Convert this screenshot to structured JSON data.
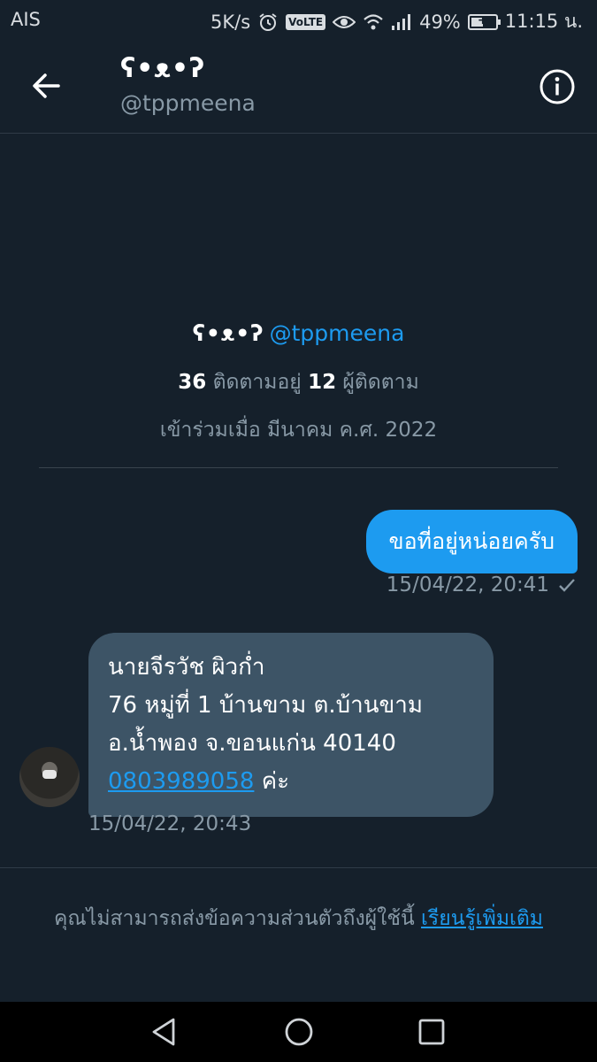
{
  "status_bar": {
    "carrier": "AIS",
    "speed": "5K/s",
    "volte": "VoLTE",
    "battery": "49%",
    "battery_level": 0.49,
    "time": "11:15 น."
  },
  "header": {
    "name": "ʕ•ᴥ•ʔ",
    "handle": "@tppmeena"
  },
  "profile": {
    "name": "ʕ•ᴥ•ʔ",
    "handle": "@tppmeena",
    "following_count": "36",
    "following_label": "ติดตามอยู่",
    "followers_count": "12",
    "followers_label": "ผู้ติดตาม",
    "joined": "เข้าร่วมเมื่อ มีนาคม ค.ศ. 2022"
  },
  "messages": {
    "outgoing": {
      "text": "ขอที่อยู่หน่อยครับ",
      "time": "15/04/22, 20:41"
    },
    "incoming": {
      "line1": "นายจีรวัช ผิวก่ำ",
      "line2": "76 หมู่ที่ 1 บ้านขาม ต.บ้านขาม",
      "line3": "อ.น้ำพอง จ.ขอนแก่น 40140",
      "phone": "0803989058",
      "suffix": "ค่ะ",
      "time": "15/04/22, 20:43"
    }
  },
  "footer": {
    "notice": "คุณไม่สามารถส่งข้อความส่วนตัวถึงผู้ใช้นี้",
    "learn_more": "เรียนรู้เพิ่มเติม"
  },
  "colors": {
    "background": "#15202b",
    "accent": "#1d9bf0",
    "incoming_bubble": "#3d5466",
    "muted_text": "#8899a6"
  }
}
